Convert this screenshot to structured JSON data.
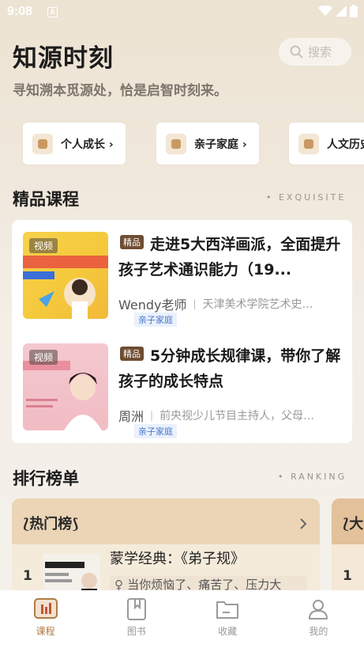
{
  "status_bar": {
    "time": "9:08",
    "badge": "A"
  },
  "header": {
    "title": "知源时刻",
    "search_placeholder": "搜索",
    "slogan": "寻知溯本觅源处，恰是启智时刻来。"
  },
  "categories": [
    {
      "label": "个人成长 ›",
      "icon": "growth-icon"
    },
    {
      "label": "亲子家庭 ›",
      "icon": "family-icon"
    },
    {
      "label": "人文历史",
      "icon": "history-icon"
    }
  ],
  "featured": {
    "title": "精品课程",
    "subtitle": "• EXQUISITE",
    "courses": [
      {
        "badge": "视频",
        "tag": "精品",
        "title": "走进5大西洋画派，全面提升孩子艺术通识能力（19...",
        "teacher": "Wendy老师",
        "desc": "天津美术学院艺术史…",
        "category": "亲子家庭"
      },
      {
        "badge": "视频",
        "tag": "精品",
        "title": "5分钟成长规律课，带你了解孩子的成长特点",
        "teacher": "周洲",
        "desc": "前央视少儿节目主持人，父母…",
        "category": "亲子家庭"
      }
    ]
  },
  "ranking": {
    "title": "排行榜单",
    "subtitle": "• RANKING",
    "hot_title": "热门榜",
    "second_title": "大",
    "top_item": {
      "rank": "1",
      "title": "蒙学经典：《弟子规》",
      "desc": "当你烦恼了、痛苦了、压力大"
    },
    "second_rank": "1"
  },
  "tabbar": [
    {
      "label": "课程",
      "icon": "course-icon",
      "active": true
    },
    {
      "label": "图书",
      "icon": "book-icon",
      "active": false
    },
    {
      "label": "收藏",
      "icon": "folder-icon",
      "active": false
    },
    {
      "label": "我的",
      "icon": "profile-icon",
      "active": false
    }
  ],
  "colors": {
    "accent": "#b07a45",
    "tag_brown": "#6e4d32",
    "tag_blue": "#4a79c8"
  }
}
